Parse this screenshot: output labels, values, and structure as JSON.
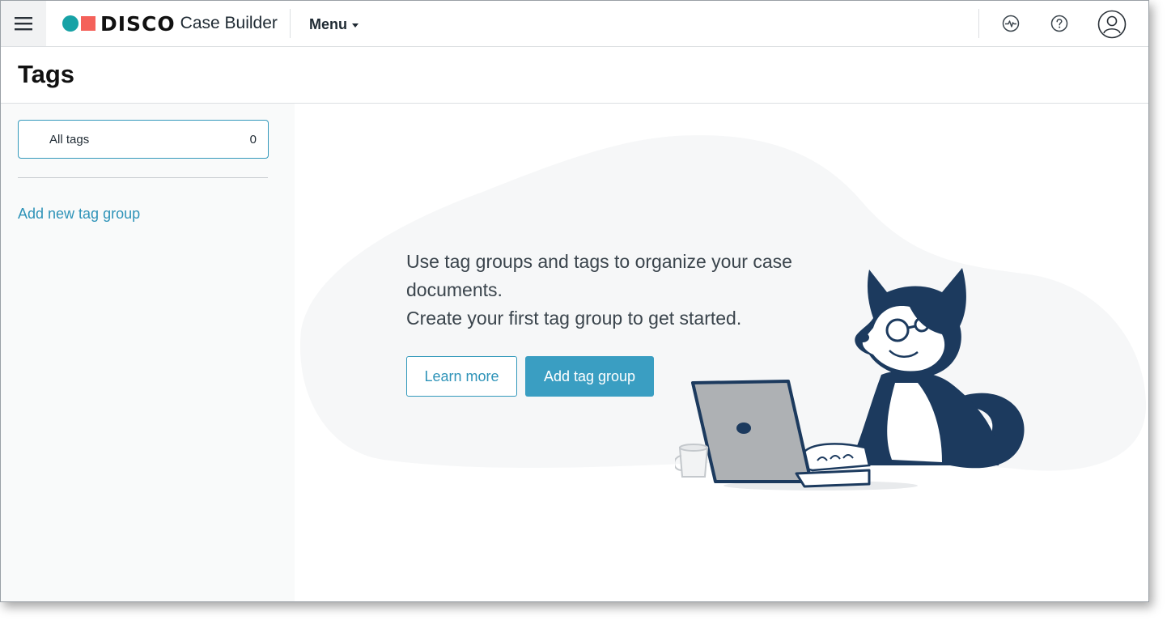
{
  "header": {
    "brand": "DISCO",
    "product": "Case Builder",
    "menu_label": "Menu"
  },
  "icons": {
    "menu": "hamburger-icon",
    "activity": "activity-pulse-icon",
    "help": "help-question-icon",
    "account": "user-account-icon"
  },
  "colors": {
    "brand_teal": "#17a2a6",
    "brand_red": "#f4615a",
    "accent": "#3a9ec2",
    "husky_navy": "#1c3a5e"
  },
  "page": {
    "title": "Tags"
  },
  "sidebar": {
    "all_tags": {
      "label": "All tags",
      "count": "0"
    },
    "add_group_link": "Add new tag group"
  },
  "empty_state": {
    "line1": "Use tag groups and tags to organize your case documents.",
    "line2": "Create your first tag group to get started.",
    "learn_more": "Learn more",
    "add_tag_group": "Add tag group"
  }
}
